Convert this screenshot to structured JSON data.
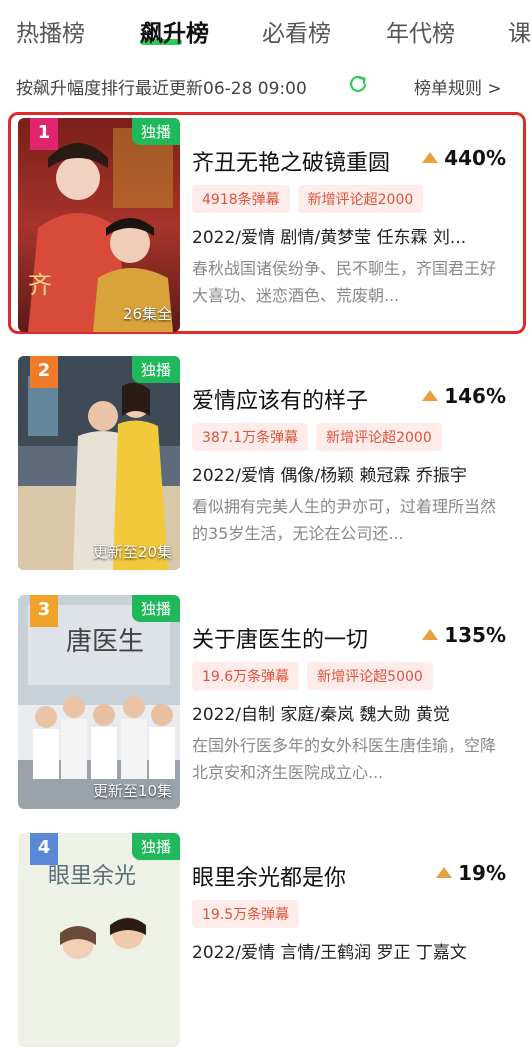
{
  "tabs": [
    {
      "label": "热播榜"
    },
    {
      "label": "飙升榜"
    },
    {
      "label": "必看榜"
    },
    {
      "label": "年代榜"
    },
    {
      "label": "课"
    }
  ],
  "subbar": {
    "text": "按飙升幅度排行最近更新06-28 09:00",
    "rules": "榜单规则 >"
  },
  "colors": {
    "accent": "#2ecc5a",
    "exclusive": "#1fb85a",
    "highlight": "#e02a2a",
    "trend": "#e8a23c"
  },
  "items": [
    {
      "rank": "1",
      "rank_color": "#e0246d",
      "badge": "独播",
      "episodes": "26集全",
      "title": "齐丑无艳之破镜重圆",
      "trend": "440%",
      "tags": [
        "4918条弹幕",
        "新增评论超2000"
      ],
      "meta": "2022/爱情 剧情/黄梦莹 任东霖 刘...",
      "desc": "春秋战国诸侯纷争、民不聊生，齐国君王好大喜功、迷恋酒色、荒废朝..."
    },
    {
      "rank": "2",
      "rank_color": "#f07a2a",
      "badge": "独播",
      "episodes": "更新至20集",
      "title": "爱情应该有的样子",
      "trend": "146%",
      "tags": [
        "387.1万条弹幕",
        "新增评论超2000"
      ],
      "meta": "2022/爱情 偶像/杨颖 赖冠霖 乔振宇",
      "desc": "看似拥有完美人生的尹亦可，过着理所当然的35岁生活，无论在公司还..."
    },
    {
      "rank": "3",
      "rank_color": "#f0a32a",
      "badge": "独播",
      "episodes": "更新至10集",
      "title": "关于唐医生的一切",
      "trend": "135%",
      "tags": [
        "19.6万条弹幕",
        "新增评论超5000"
      ],
      "meta": "2022/自制 家庭/秦岚 魏大勋 黄觉",
      "desc": "在国外行医多年的女外科医生唐佳瑜，空降北京安和济生医院成立心..."
    },
    {
      "rank": "4",
      "rank_color": "#5a87d6",
      "badge": "独播",
      "episodes": "",
      "title": "眼里余光都是你",
      "trend": "19%",
      "tags": [
        "19.5万条弹幕"
      ],
      "meta": "2022/爱情 言情/王鹤润 罗正 丁嘉文",
      "desc": ""
    }
  ]
}
